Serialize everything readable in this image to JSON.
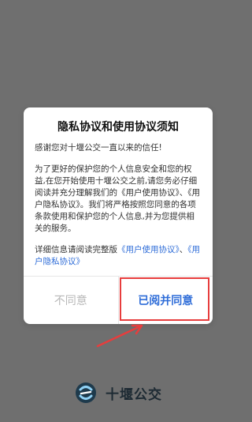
{
  "dialog": {
    "title": "隐私协议和使用协议须知",
    "paragraph1": "感谢您对十堰公交一直以来的信任!",
    "paragraph2": "为了更好的保护您的个人信息安全和您的权益,在您开始使用十堰公交之前,请您务必仔细阅读并充分理解我们的《用户使用协议》、《用户隐私协议》。我们将严格按照您同意的各项条款使用和保护您的个人信息,并为您提供相关的服务。",
    "paragraph3_prefix": "详细信息请阅读完整版",
    "link_usage": "《用户使用协议》",
    "separator": "、",
    "link_privacy": "《用户隐私协议》",
    "disagree_label": "不同意",
    "agree_label": "已阅并同意"
  },
  "brand": {
    "name": "十堰公交",
    "logo_icon": "bus-logo-icon"
  },
  "colors": {
    "accent": "#2f6dd8",
    "highlight": "#e73d3d",
    "background": "#6f6f6f"
  }
}
